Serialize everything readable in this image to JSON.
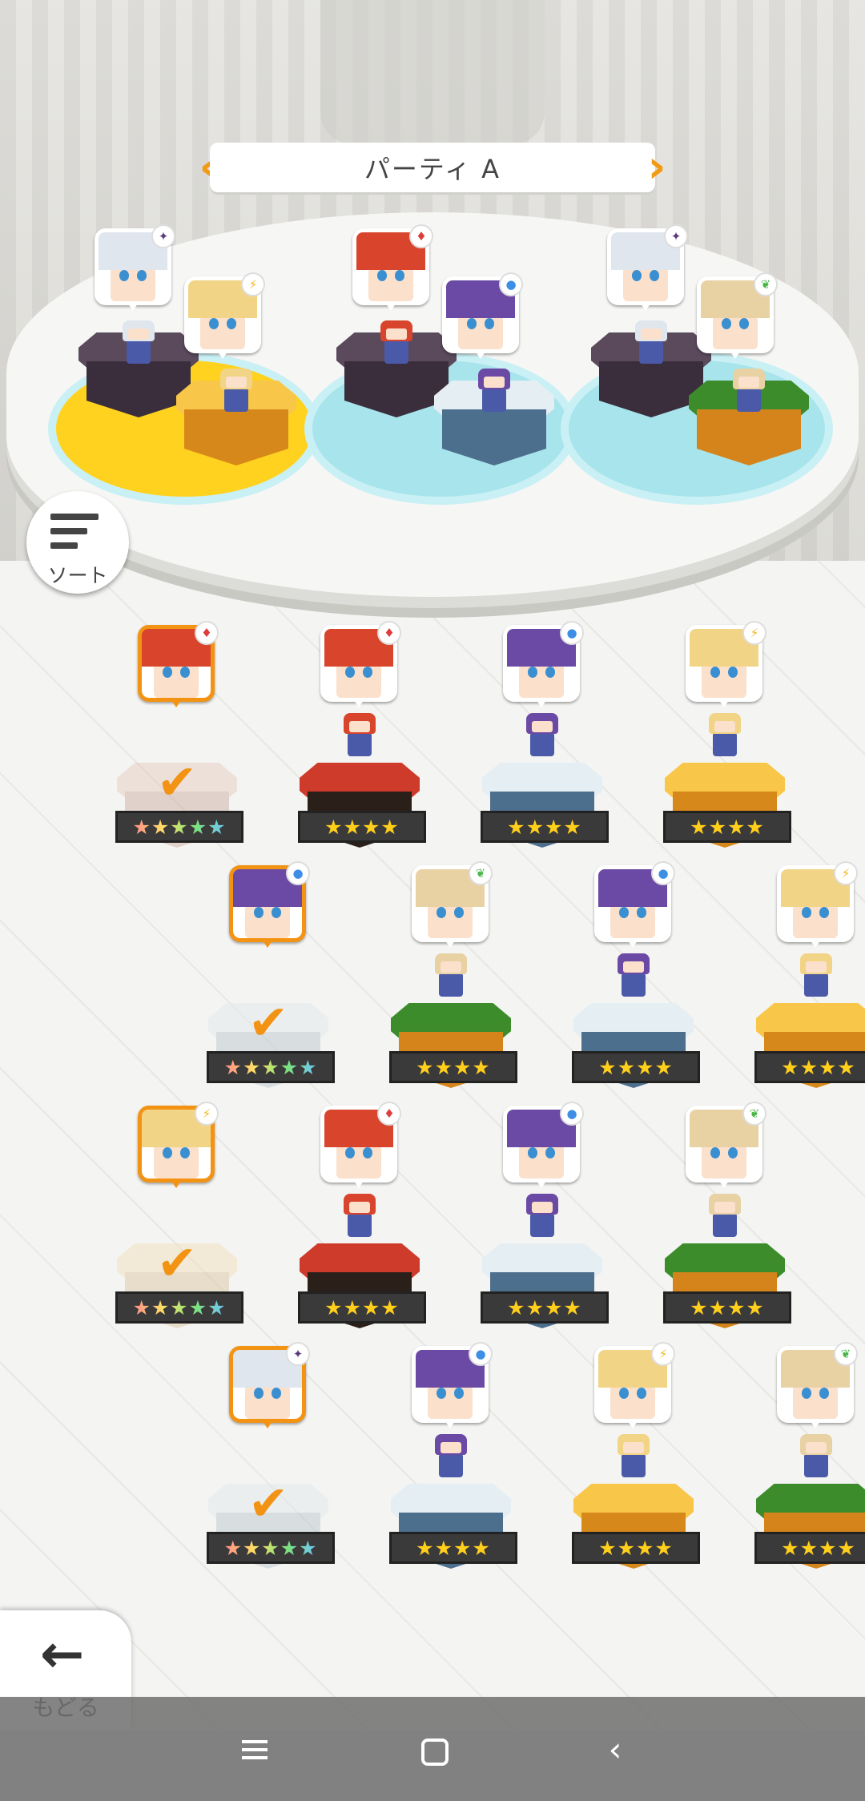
{
  "party": {
    "title": "パーティ A",
    "prev_icon": "chevron-left-icon",
    "next_icon": "chevron-right-icon"
  },
  "buttons": {
    "sort_label": "ソート",
    "back_label": "もどる"
  },
  "party_members": [
    {
      "slot": 1,
      "element": "dark"
    },
    {
      "slot": 1,
      "element": "light"
    },
    {
      "slot": 2,
      "element": "fire"
    },
    {
      "slot": 2,
      "element": "water"
    },
    {
      "slot": 3,
      "element": "dark"
    },
    {
      "slot": 3,
      "element": "wind"
    }
  ],
  "roster": [
    {
      "element": "fire",
      "stars": "★★★★★",
      "rarity": 5,
      "in_party": true
    },
    {
      "element": "fire",
      "stars": "★★★★",
      "rarity": 4,
      "in_party": false
    },
    {
      "element": "water",
      "stars": "★★★★",
      "rarity": 4,
      "in_party": false
    },
    {
      "element": "light",
      "stars": "★★★★",
      "rarity": 4,
      "in_party": false
    },
    {
      "element": "water",
      "stars": "★★★★★",
      "rarity": 5,
      "in_party": true
    },
    {
      "element": "wind",
      "stars": "★★★★",
      "rarity": 4,
      "in_party": false
    },
    {
      "element": "water",
      "stars": "★★★★",
      "rarity": 4,
      "in_party": false
    },
    {
      "element": "light",
      "stars": "★★★★",
      "rarity": 4,
      "in_party": false
    },
    {
      "element": "light",
      "stars": "★★★★★",
      "rarity": 5,
      "in_party": true
    },
    {
      "element": "fire",
      "stars": "★★★★",
      "rarity": 4,
      "in_party": false
    },
    {
      "element": "water",
      "stars": "★★★★",
      "rarity": 4,
      "in_party": false
    },
    {
      "element": "wind",
      "stars": "★★★★",
      "rarity": 4,
      "in_party": false
    },
    {
      "element": "dark",
      "stars": "★★★★★",
      "rarity": 5,
      "in_party": true
    },
    {
      "element": "water",
      "stars": "★★★★",
      "rarity": 4,
      "in_party": false
    },
    {
      "element": "light",
      "stars": "★★★★",
      "rarity": 4,
      "in_party": false
    },
    {
      "element": "wind",
      "stars": "★★★★",
      "rarity": 4,
      "in_party": false
    }
  ],
  "element_glyphs": {
    "fire": "♦",
    "water": "●",
    "light": "⚡",
    "wind": "❦",
    "dark": "✦"
  },
  "colors": {
    "accent": "#f39313",
    "star": "#ffcf1c"
  },
  "navbar": {
    "menu_icon": "menu-icon",
    "home_icon": "home-square-icon",
    "back_icon": "back-triangle-icon"
  }
}
